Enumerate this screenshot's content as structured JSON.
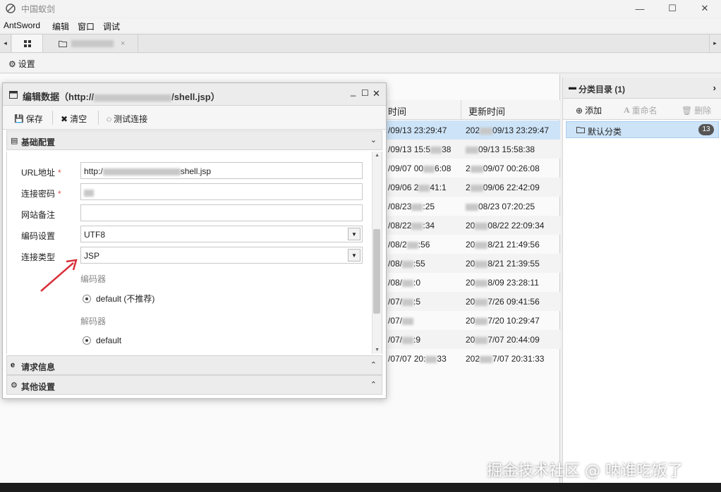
{
  "window": {
    "title": "中国蚁剑",
    "minimize": "—",
    "maximize": "☐",
    "close": "✕"
  },
  "menubar": [
    "AntSword",
    "编辑",
    "窗口",
    "调试"
  ],
  "tabs": {
    "left_arrow": "◂",
    "right_arrow": "▸",
    "grid_icon": "grid-icon",
    "tab_close": "×"
  },
  "settings": {
    "label": "设置"
  },
  "list": {
    "col1_header": "时间",
    "col2_header": "更新时间",
    "rows": [
      {
        "c1_suffix": "/09/13 23:29:47",
        "c2_prefix": "202",
        "c2_suffix": "09/13 23:29:47"
      },
      {
        "c1_suffix": "/09/13 15:5",
        "c1_end": "38",
        "c2_prefix": "",
        "c2_suffix": "09/13 15:58:38"
      },
      {
        "c1_suffix": "/09/07 00",
        "c1_end": "6:08",
        "c2_prefix": "2",
        "c2_suffix": "09/07 00:26:08"
      },
      {
        "c1_suffix": "/09/06 2",
        "c1_end": "41:1",
        "c2_prefix": "2",
        "c2_suffix": "09/06 22:42:09"
      },
      {
        "c1_suffix": "/08/23",
        "c1_end": ":25",
        "c2_prefix": "",
        "c2_suffix": "08/23 07:20:25"
      },
      {
        "c1_suffix": "/08/22",
        "c1_end": ":34",
        "c2_prefix": "20",
        "c2_suffix": "08/22 22:09:34"
      },
      {
        "c1_suffix": "/08/2",
        "c1_end": ":56",
        "c2_prefix": "20",
        "c2_suffix": "8/21 21:49:56"
      },
      {
        "c1_suffix": "/08/",
        "c1_end": ":55",
        "c2_prefix": "20",
        "c2_suffix": "8/21 21:39:55"
      },
      {
        "c1_suffix": "/08/",
        "c1_end": ":0",
        "c2_prefix": "20",
        "c2_suffix": "8/09 23:28:11"
      },
      {
        "c1_suffix": "/07/",
        "c1_end": ":5",
        "c2_prefix": "20",
        "c2_suffix": "7/26 09:41:56"
      },
      {
        "c1_suffix": "/07/",
        "c1_end": "",
        "c2_prefix": "20",
        "c2_suffix": "7/20 10:29:47"
      },
      {
        "c1_suffix": "/07/",
        "c1_end": ":9",
        "c2_prefix": "20",
        "c2_suffix": "7/07 20:44:09"
      },
      {
        "c1_suffix": "/07/07 20:",
        "c1_end": "33",
        "c2_prefix": "202",
        "c2_suffix": "7/07 20:31:33"
      }
    ]
  },
  "category_panel": {
    "title": "分类目录 (1)",
    "add_label": "添加",
    "rename_label": "重命名",
    "delete_label": "删除",
    "default_category": "默认分类",
    "default_count": "13"
  },
  "dialog": {
    "title": "编辑数据（http://",
    "title_end": "/shell.jsp）",
    "save": "保存",
    "clear": "清空",
    "test": "测试连接",
    "section_basic": "基础配置",
    "section_request": "请求信息",
    "section_other": "其他设置",
    "fields": {
      "url_label": "URL地址",
      "url_value_start": "http:/",
      "url_value_end": "shell.jsp",
      "password_label": "连接密码",
      "note_label": "网站备注",
      "encoding_label": "编码设置",
      "encoding_value": "UTF8",
      "type_label": "连接类型",
      "type_value": "JSP",
      "required_mark": "*"
    },
    "encoder_label": "编码器",
    "encoder_option": "default (不推荐)",
    "decoder_label": "解码器",
    "decoder_option": "default"
  },
  "watermark": "掘金技术社区 @ 呐谁吃饭了"
}
